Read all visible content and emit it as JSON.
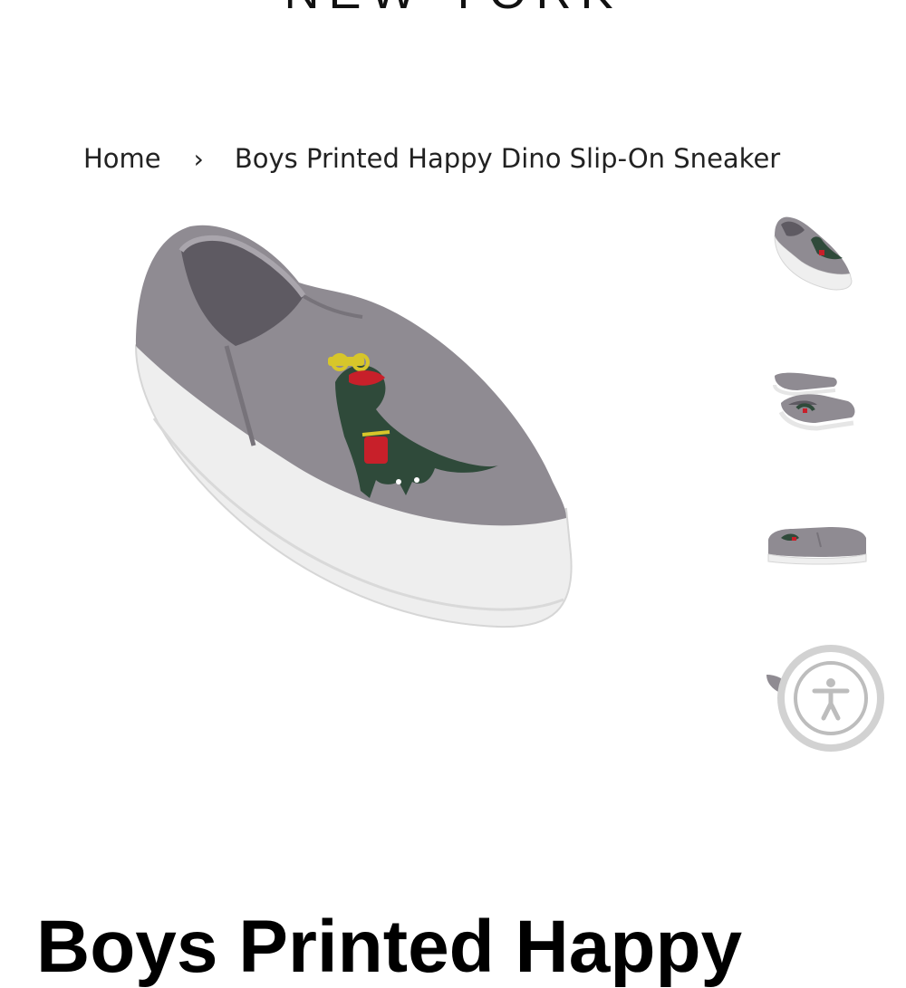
{
  "header": {
    "brand_text": "NEW YORK"
  },
  "breadcrumb": {
    "home_label": "Home",
    "separator": "›",
    "current_label": "Boys Printed Happy Dino Slip-On Sneaker"
  },
  "product": {
    "title": "Boys Printed Happy",
    "main_image_icon": "slip-on-sneaker-dino-image",
    "thumbnails": [
      {
        "icon": "sneaker-side-angle-thumbnail"
      },
      {
        "icon": "sneaker-pair-thumbnail"
      },
      {
        "icon": "sneaker-side-profile-thumbnail"
      },
      {
        "icon": "sneaker-partial-thumbnail"
      }
    ]
  },
  "accessibility": {
    "icon": "accessibility-person-icon"
  },
  "colors": {
    "shoe_upper": "#8e8a90",
    "shoe_sole": "#ededed",
    "dino": "#2f4a3a",
    "accent_red": "#c8202a",
    "accent_yellow": "#d7c62a",
    "a11y_ring": "#d2d2d2"
  }
}
